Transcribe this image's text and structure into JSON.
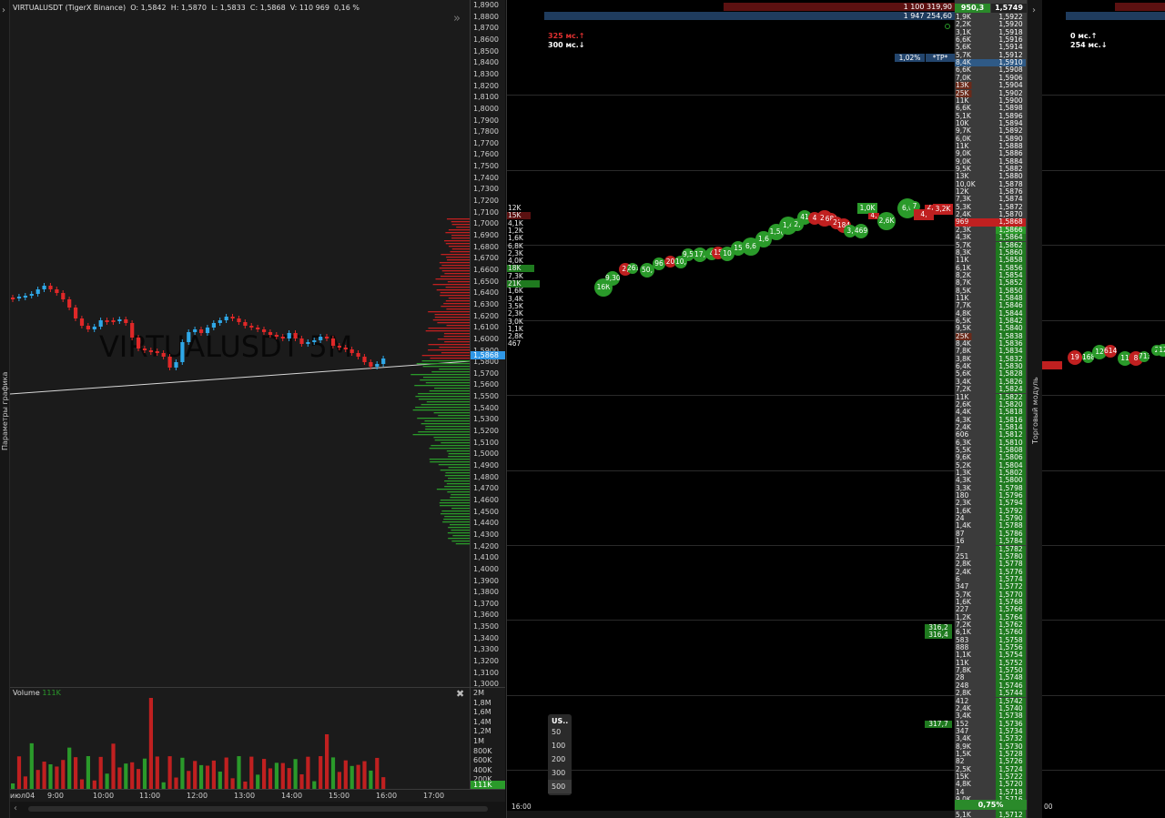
{
  "chart": {
    "header": {
      "symbol": "VIRTUALUSDT (TigerX Binance)",
      "o_label": "O:",
      "o": "1,5842",
      "h_label": "H:",
      "h": "1,5870",
      "l_label": "L:",
      "l": "1,5833",
      "c_label": "C:",
      "c": "1,5868",
      "v_label": "V:",
      "v": "110 969",
      "change": "0,16 %"
    },
    "watermark": "VIRTUALUSDT 5M",
    "side_label": "Параметры графика",
    "price_ticks": [
      "1,8900",
      "1,8800",
      "1,8700",
      "1,8600",
      "1,8500",
      "1,8400",
      "1,8300",
      "1,8200",
      "1,8100",
      "1,8000",
      "1,7900",
      "1,7800",
      "1,7700",
      "1,7600",
      "1,7500",
      "1,7400",
      "1,7300",
      "1,7200",
      "1,7100",
      "1,7000",
      "1,6900",
      "1,6800",
      "1,6700",
      "1,6600",
      "1,6500",
      "1,6400",
      "1,6300",
      "1,6200",
      "1,6100",
      "1,6000",
      "1,5900",
      "1,5800",
      "1,5700",
      "1,5600",
      "1,5500",
      "1,5400",
      "1,5300",
      "1,5200",
      "1,5100",
      "1,5000",
      "1,4900",
      "1,4800",
      "1,4700",
      "1,4600",
      "1,4500",
      "1,4400",
      "1,4300",
      "1,4200",
      "1,4100",
      "1,4000",
      "1,3900",
      "1,3800",
      "1,3700",
      "1,3600",
      "1,3500",
      "1,3400",
      "1,3300",
      "1,3200",
      "1,3100",
      "1,3000"
    ],
    "current_price": "1,5868",
    "volume_title": "Volume",
    "volume_value": "111K",
    "volume_ticks": [
      "2M",
      "1,8M",
      "1,6M",
      "1,4M",
      "1,2M",
      "1M",
      "800K",
      "600K",
      "400K",
      "200K",
      "0"
    ],
    "volume_current": "111K",
    "time_ticks": [
      "июл04",
      "9:00",
      "10:00",
      "11:00",
      "12:00",
      "13:00",
      "14:00",
      "15:00",
      "16:00",
      "17:00"
    ],
    "colors": {
      "up": "#2fa8e8",
      "down": "#e02828",
      "vol_up": "#2a9a2a",
      "vol_down": "#c02020",
      "bg": "#1b1b1b"
    }
  },
  "clusters": [
    "12K",
    "15K",
    "4,1K",
    "1,2K",
    "1,6K",
    "6,8K",
    "2,3K",
    "4,0K",
    "18K",
    "7,3K",
    "21K",
    "1,6K",
    "3,4K",
    "3,5K",
    "2,3K",
    "3,0K",
    "1,1K",
    "2,8K",
    "467"
  ],
  "tape": {
    "latency_up": "325 мс.↑",
    "latency_down": "300 мс.↓",
    "time_label": "16:00",
    "tp_pct": "1,02%",
    "tp_label": "*TP*",
    "top_big": "1 100 319,90",
    "top_big2": "1 947 254,60",
    "top_bid": "950,3",
    "top_price": "1,5749",
    "bubbles": [
      "16К",
      "9,30",
      "2,",
      "261",
      "50,",
      "96",
      "20",
      "10,",
      "9,5",
      "17,",
      "4",
      "15",
      "10",
      "15",
      "6,6",
      "1,6",
      "1,5(",
      "1,4",
      "2,",
      "41",
      "4",
      "2,(",
      "68(",
      "2(",
      "184",
      "3,",
      "469",
      "1,0K",
      "4,",
      "2,6K",
      "6,0",
      "7",
      "4,",
      "2,",
      "3,2K"
    ],
    "limit_orders": [
      "316,2",
      "316,4",
      "317,7"
    ],
    "size_selector": {
      "title": "US..",
      "options": [
        "50",
        "100",
        "200",
        "300",
        "500"
      ]
    },
    "spread_pct": "0,75%"
  },
  "ladder": {
    "rows": [
      [
        "1,9K",
        "1,5922"
      ],
      [
        "2,2K",
        "1,5920"
      ],
      [
        "3,1K",
        "1,5918"
      ],
      [
        "6,6K",
        "1,5916"
      ],
      [
        "5,6K",
        "1,5914"
      ],
      [
        "5,7K",
        "1,5912"
      ],
      [
        "8,4K",
        "1,5910"
      ],
      [
        "6,6K",
        "1,5908"
      ],
      [
        "7,0K",
        "1,5906"
      ],
      [
        "13K",
        "1,5904"
      ],
      [
        "25K",
        "1,5902"
      ],
      [
        "11K",
        "1,5900"
      ],
      [
        "6,6K",
        "1,5898"
      ],
      [
        "5,1K",
        "1,5896"
      ],
      [
        "10K",
        "1,5894"
      ],
      [
        "9,7K",
        "1,5892"
      ],
      [
        "6,0K",
        "1,5890"
      ],
      [
        "11K",
        "1,5888"
      ],
      [
        "9,0K",
        "1,5886"
      ],
      [
        "9,0K",
        "1,5884"
      ],
      [
        "9,5K",
        "1,5882"
      ],
      [
        "13K",
        "1,5880"
      ],
      [
        "10,0K",
        "1,5878"
      ],
      [
        "12K",
        "1,5876"
      ],
      [
        "7,3K",
        "1,5874"
      ],
      [
        "5,3K",
        "1,5872"
      ],
      [
        "2,4K",
        "1,5870"
      ],
      [
        "969",
        "1,5868"
      ],
      [
        "2,3K",
        "1,5866"
      ],
      [
        "4,3K",
        "1,5864"
      ],
      [
        "5,7K",
        "1,5862"
      ],
      [
        "8,3K",
        "1,5860"
      ],
      [
        "11K",
        "1,5858"
      ],
      [
        "6,1K",
        "1,5856"
      ],
      [
        "8,2K",
        "1,5854"
      ],
      [
        "8,7K",
        "1,5852"
      ],
      [
        "8,5K",
        "1,5850"
      ],
      [
        "11K",
        "1,5848"
      ],
      [
        "7,7K",
        "1,5846"
      ],
      [
        "4,8K",
        "1,5844"
      ],
      [
        "6,5K",
        "1,5842"
      ],
      [
        "9,5K",
        "1,5840"
      ],
      [
        "25K",
        "1,5838"
      ],
      [
        "8,4K",
        "1,5836"
      ],
      [
        "7,8K",
        "1,5834"
      ],
      [
        "3,8K",
        "1,5832"
      ],
      [
        "6,4K",
        "1,5830"
      ],
      [
        "5,6K",
        "1,5828"
      ],
      [
        "3,4K",
        "1,5826"
      ],
      [
        "7,2K",
        "1,5824"
      ],
      [
        "11K",
        "1,5822"
      ],
      [
        "2,6K",
        "1,5820"
      ],
      [
        "4,4K",
        "1,5818"
      ],
      [
        "4,3K",
        "1,5816"
      ],
      [
        "2,4K",
        "1,5814"
      ],
      [
        "606",
        "1,5812"
      ],
      [
        "6,3K",
        "1,5810"
      ],
      [
        "5,5K",
        "1,5808"
      ],
      [
        "9,6K",
        "1,5806"
      ],
      [
        "5,2K",
        "1,5804"
      ],
      [
        "1,3K",
        "1,5802"
      ],
      [
        "4,3K",
        "1,5800"
      ],
      [
        "3,3K",
        "1,5798"
      ],
      [
        "180",
        "1,5796"
      ],
      [
        "2,3K",
        "1,5794"
      ],
      [
        "1,6K",
        "1,5792"
      ],
      [
        "24",
        "1,5790"
      ],
      [
        "1,4K",
        "1,5788"
      ],
      [
        "87",
        "1,5786"
      ],
      [
        "16",
        "1,5784"
      ],
      [
        "7",
        "1,5782"
      ],
      [
        "251",
        "1,5780"
      ],
      [
        "2,8K",
        "1,5778"
      ],
      [
        "2,4K",
        "1,5776"
      ],
      [
        "6",
        "1,5774"
      ],
      [
        "347",
        "1,5772"
      ],
      [
        "5,7K",
        "1,5770"
      ],
      [
        "1,6K",
        "1,5768"
      ],
      [
        "227",
        "1,5766"
      ],
      [
        "1,2K",
        "1,5764"
      ],
      [
        "7,2K",
        "1,5762"
      ],
      [
        "6,1K",
        "1,5760"
      ],
      [
        "583",
        "1,5758"
      ],
      [
        "888",
        "1,5756"
      ],
      [
        "1,1K",
        "1,5754"
      ],
      [
        "11K",
        "1,5752"
      ],
      [
        "7,8K",
        "1,5750"
      ],
      [
        "28",
        "1,5748"
      ],
      [
        "248",
        "1,5746"
      ],
      [
        "2,8K",
        "1,5744"
      ],
      [
        "412",
        "1,5742"
      ],
      [
        "2,4K",
        "1,5740"
      ],
      [
        "3,4K",
        "1,5738"
      ],
      [
        "152",
        "1,5736"
      ],
      [
        "347",
        "1,5734"
      ],
      [
        "3,4K",
        "1,5732"
      ],
      [
        "8,9K",
        "1,5730"
      ],
      [
        "1,5K",
        "1,5728"
      ],
      [
        "82",
        "1,5726"
      ],
      [
        "2,5K",
        "1,5724"
      ],
      [
        "15K",
        "1,5722"
      ],
      [
        "4,8K",
        "1,5720"
      ],
      [
        "14",
        "1,5718"
      ],
      [
        "9,0K",
        "1,5716"
      ],
      [
        "224",
        "1,5714"
      ],
      [
        "5,1K",
        "1,5712"
      ]
    ]
  },
  "trading_module": {
    "side_label": "Торговый модуль",
    "latency_up": "0 мс.↑",
    "latency_down": "254 мс.↓",
    "time_label": "00",
    "bubbles": [
      "19",
      "168",
      "12",
      "614",
      "11",
      "8",
      "713",
      "2",
      "12"
    ]
  }
}
